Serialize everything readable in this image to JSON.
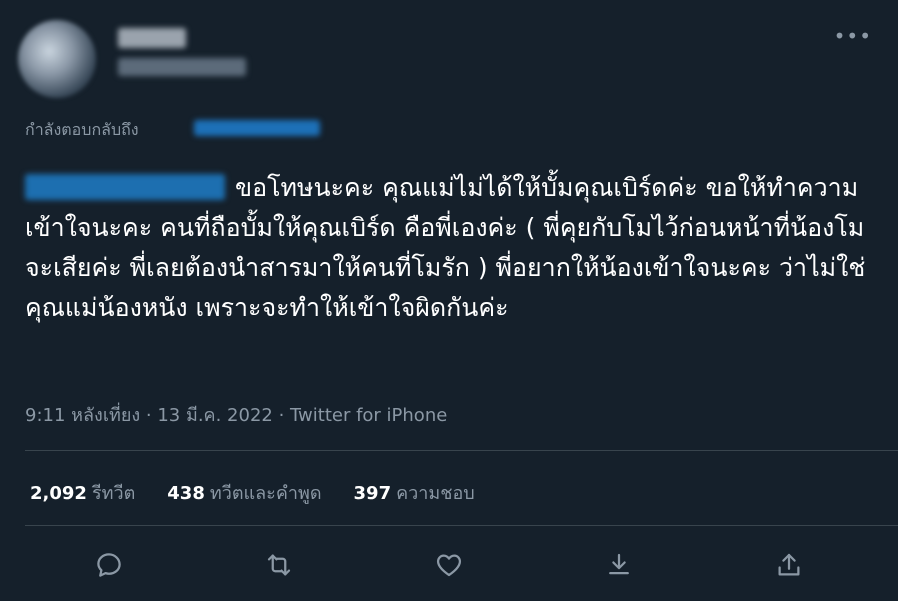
{
  "reply": {
    "prefix": "กำลังตอบกลับถึง"
  },
  "tweet": {
    "text": "ขอโทษนะคะ คุณแม่ไม่ได้ให้บั้มคุณเบิร์ดค่ะ ขอให้ทำความเข้าใจนะคะ คนที่ถือบั้มให้คุณเบิร์ด คือพี่เองค่ะ ( พี่คุยกับโมไว้ก่อนหน้าที่น้องโมจะเสียค่ะ พี่เลยต้องนำสารมาให้คนที่โมรัก ) พี่อยากให้น้องเข้าใจนะคะ ว่าไม่ใช่คุณแม่น้องหนัง เพราะจะทำให้เข้าใจผิดกันค่ะ"
  },
  "meta": {
    "text": "9:11 หลังเที่ยง · 13 มี.ค. 2022 · Twitter for iPhone"
  },
  "stats": {
    "retweets": {
      "count": "2,092",
      "label": "รีทวีต"
    },
    "quotes": {
      "count": "438",
      "label": "ทวีตและคำพูด"
    },
    "likes": {
      "count": "397",
      "label": "ความชอบ"
    }
  },
  "actions": [
    "reply-icon",
    "retweet-icon",
    "like-icon",
    "bookmark-icon",
    "share-icon"
  ],
  "colors": {
    "background": "#15202b",
    "text": "#ffffff",
    "secondary": "#8b98a5",
    "mention": "#1d9bf0",
    "divider": "#38444d"
  }
}
